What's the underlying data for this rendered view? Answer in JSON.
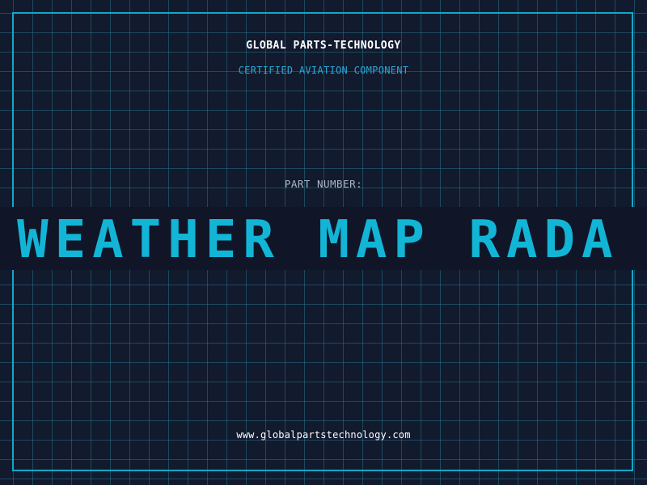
{
  "header": {
    "company": "GLOBAL PARTS-TECHNOLOGY",
    "subtitle": "CERTIFIED AVIATION COMPONENT"
  },
  "part": {
    "label": "PART NUMBER:",
    "marquee_text": "S WEATHER MAP RADA"
  },
  "footer": {
    "url": "www.globalpartstechnology.com"
  },
  "colors": {
    "background": "#121a2e",
    "grid": "#286e87",
    "frame": "#12a8c8",
    "accent": "#12b5d6",
    "label": "#aab8c8",
    "text": "#ffffff"
  }
}
